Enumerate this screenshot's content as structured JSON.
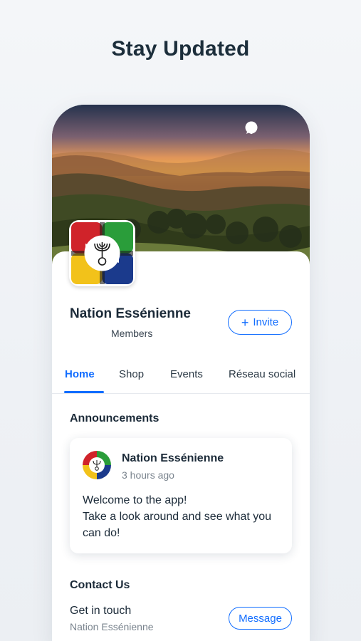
{
  "headline": "Stay Updated",
  "icons": {
    "chat": "chat-bubble-icon",
    "notifications": "bell-icon"
  },
  "group": {
    "name": "Nation Essénienne",
    "members_label": "Members"
  },
  "invite": {
    "plus": "+",
    "label": "Invite"
  },
  "tabs": [
    {
      "label": "Home",
      "active": true
    },
    {
      "label": "Shop"
    },
    {
      "label": "Events"
    },
    {
      "label": "Réseau social"
    }
  ],
  "announcements": {
    "title": "Announcements",
    "post": {
      "author": "Nation Essénienne",
      "time": "3 hours ago",
      "line1": "Welcome to the app!",
      "line2": "Take a look around and see what you can do!"
    }
  },
  "contact": {
    "title": "Contact Us",
    "subtitle": "Get in touch",
    "name": "Nation Essénienne",
    "button": "Message"
  },
  "colors": {
    "accent": "#116dff",
    "logo_red": "#d0232a",
    "logo_green": "#2a9d3a",
    "logo_yellow": "#f2c21a",
    "logo_blue": "#1b3a8c"
  }
}
